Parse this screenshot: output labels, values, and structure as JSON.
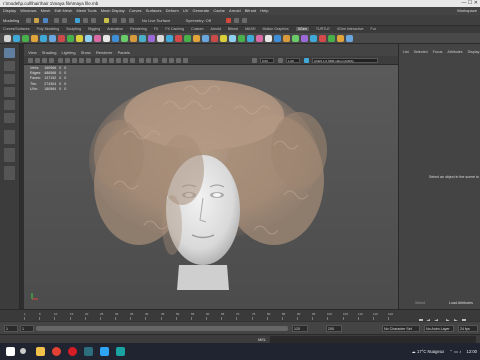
{
  "window": {
    "title": "r:\\model\\p.cull\\hair\\hair 1\\maya file\\maya file.mb",
    "controls": "— ☐ ✕"
  },
  "menubar": {
    "items": [
      "Display",
      "Windows",
      "Mesh",
      "Edit Mesh",
      "Mesh Tools",
      "Mesh Display",
      "Curves",
      "Surfaces",
      "Deform",
      "UV",
      "Generate",
      "Cache",
      "Arnold",
      "Bifrost",
      "Help"
    ],
    "workspace": "Workspace"
  },
  "status_line": {
    "mode": "Modeling",
    "live_surface": "No Live Surface",
    "symmetry": "Symmetry: Off"
  },
  "shelf_tabs": [
    "Curves/Surfaces",
    "Poly Modeling",
    "Sculpting",
    "Rigging",
    "Animation",
    "Rendering",
    "FX",
    "FX Caching",
    "Custom",
    "Arnold",
    "Bifrost",
    "MASH",
    "Motion Graphics",
    "XGen",
    "TURTLE",
    "XGen Interactive",
    "Fur"
  ],
  "shelf_active_tab": "XGen",
  "viewport": {
    "menu": [
      "View",
      "Shading",
      "Lighting",
      "Show",
      "Renderer",
      "Panels"
    ],
    "gamma": "0.00",
    "exposure": "1.00",
    "color_space": "ACES 1.0 SDR-video (ACES)",
    "hud": [
      {
        "label": "Verts:",
        "a": "160966",
        "b": "0",
        "c": "0"
      },
      {
        "label": "Edges:",
        "a": "486588",
        "b": "0",
        "c": "0"
      },
      {
        "label": "Faces:",
        "a": "137152",
        "b": "0",
        "c": "0"
      },
      {
        "label": "Tris:",
        "a": "274304",
        "b": "0",
        "c": "0"
      },
      {
        "label": "UVs:",
        "a": "180984",
        "b": "0",
        "c": "0"
      }
    ]
  },
  "right_panel": {
    "tabs": [
      "List",
      "Selected",
      "Focus",
      "Attributes",
      "Display"
    ],
    "empty_message": "Select an object in the scene to",
    "select_button": "Select",
    "load_button": "Load Attributes"
  },
  "timeslider": {
    "ticks": [
      "1",
      "5",
      "10",
      "15",
      "20",
      "25",
      "30",
      "35",
      "40",
      "45",
      "50",
      "55",
      "60",
      "65",
      "70",
      "75",
      "80",
      "85",
      "90",
      "95",
      "100",
      "105",
      "110",
      "115",
      "120"
    ]
  },
  "range": {
    "start": "1",
    "range_start": "1",
    "range_end": "120",
    "end": "120",
    "end2": "200",
    "character_set": "No Character Set",
    "anim_layer": "No Anim Layer",
    "fps": "24 fps"
  },
  "command_line": {
    "label": "MEL"
  },
  "taskbar": {
    "weather": "17°C  Nuageux",
    "time": "12:00",
    "colors": {
      "start": "#ffffff",
      "search": "#cccccc",
      "explorer": "#f2c24b",
      "chrome": "#e34133",
      "opera": "#d61c24",
      "substance": "#2c6e7d",
      "photoshop": "#2fa3f5",
      "maya": "#1aa3a0"
    }
  }
}
